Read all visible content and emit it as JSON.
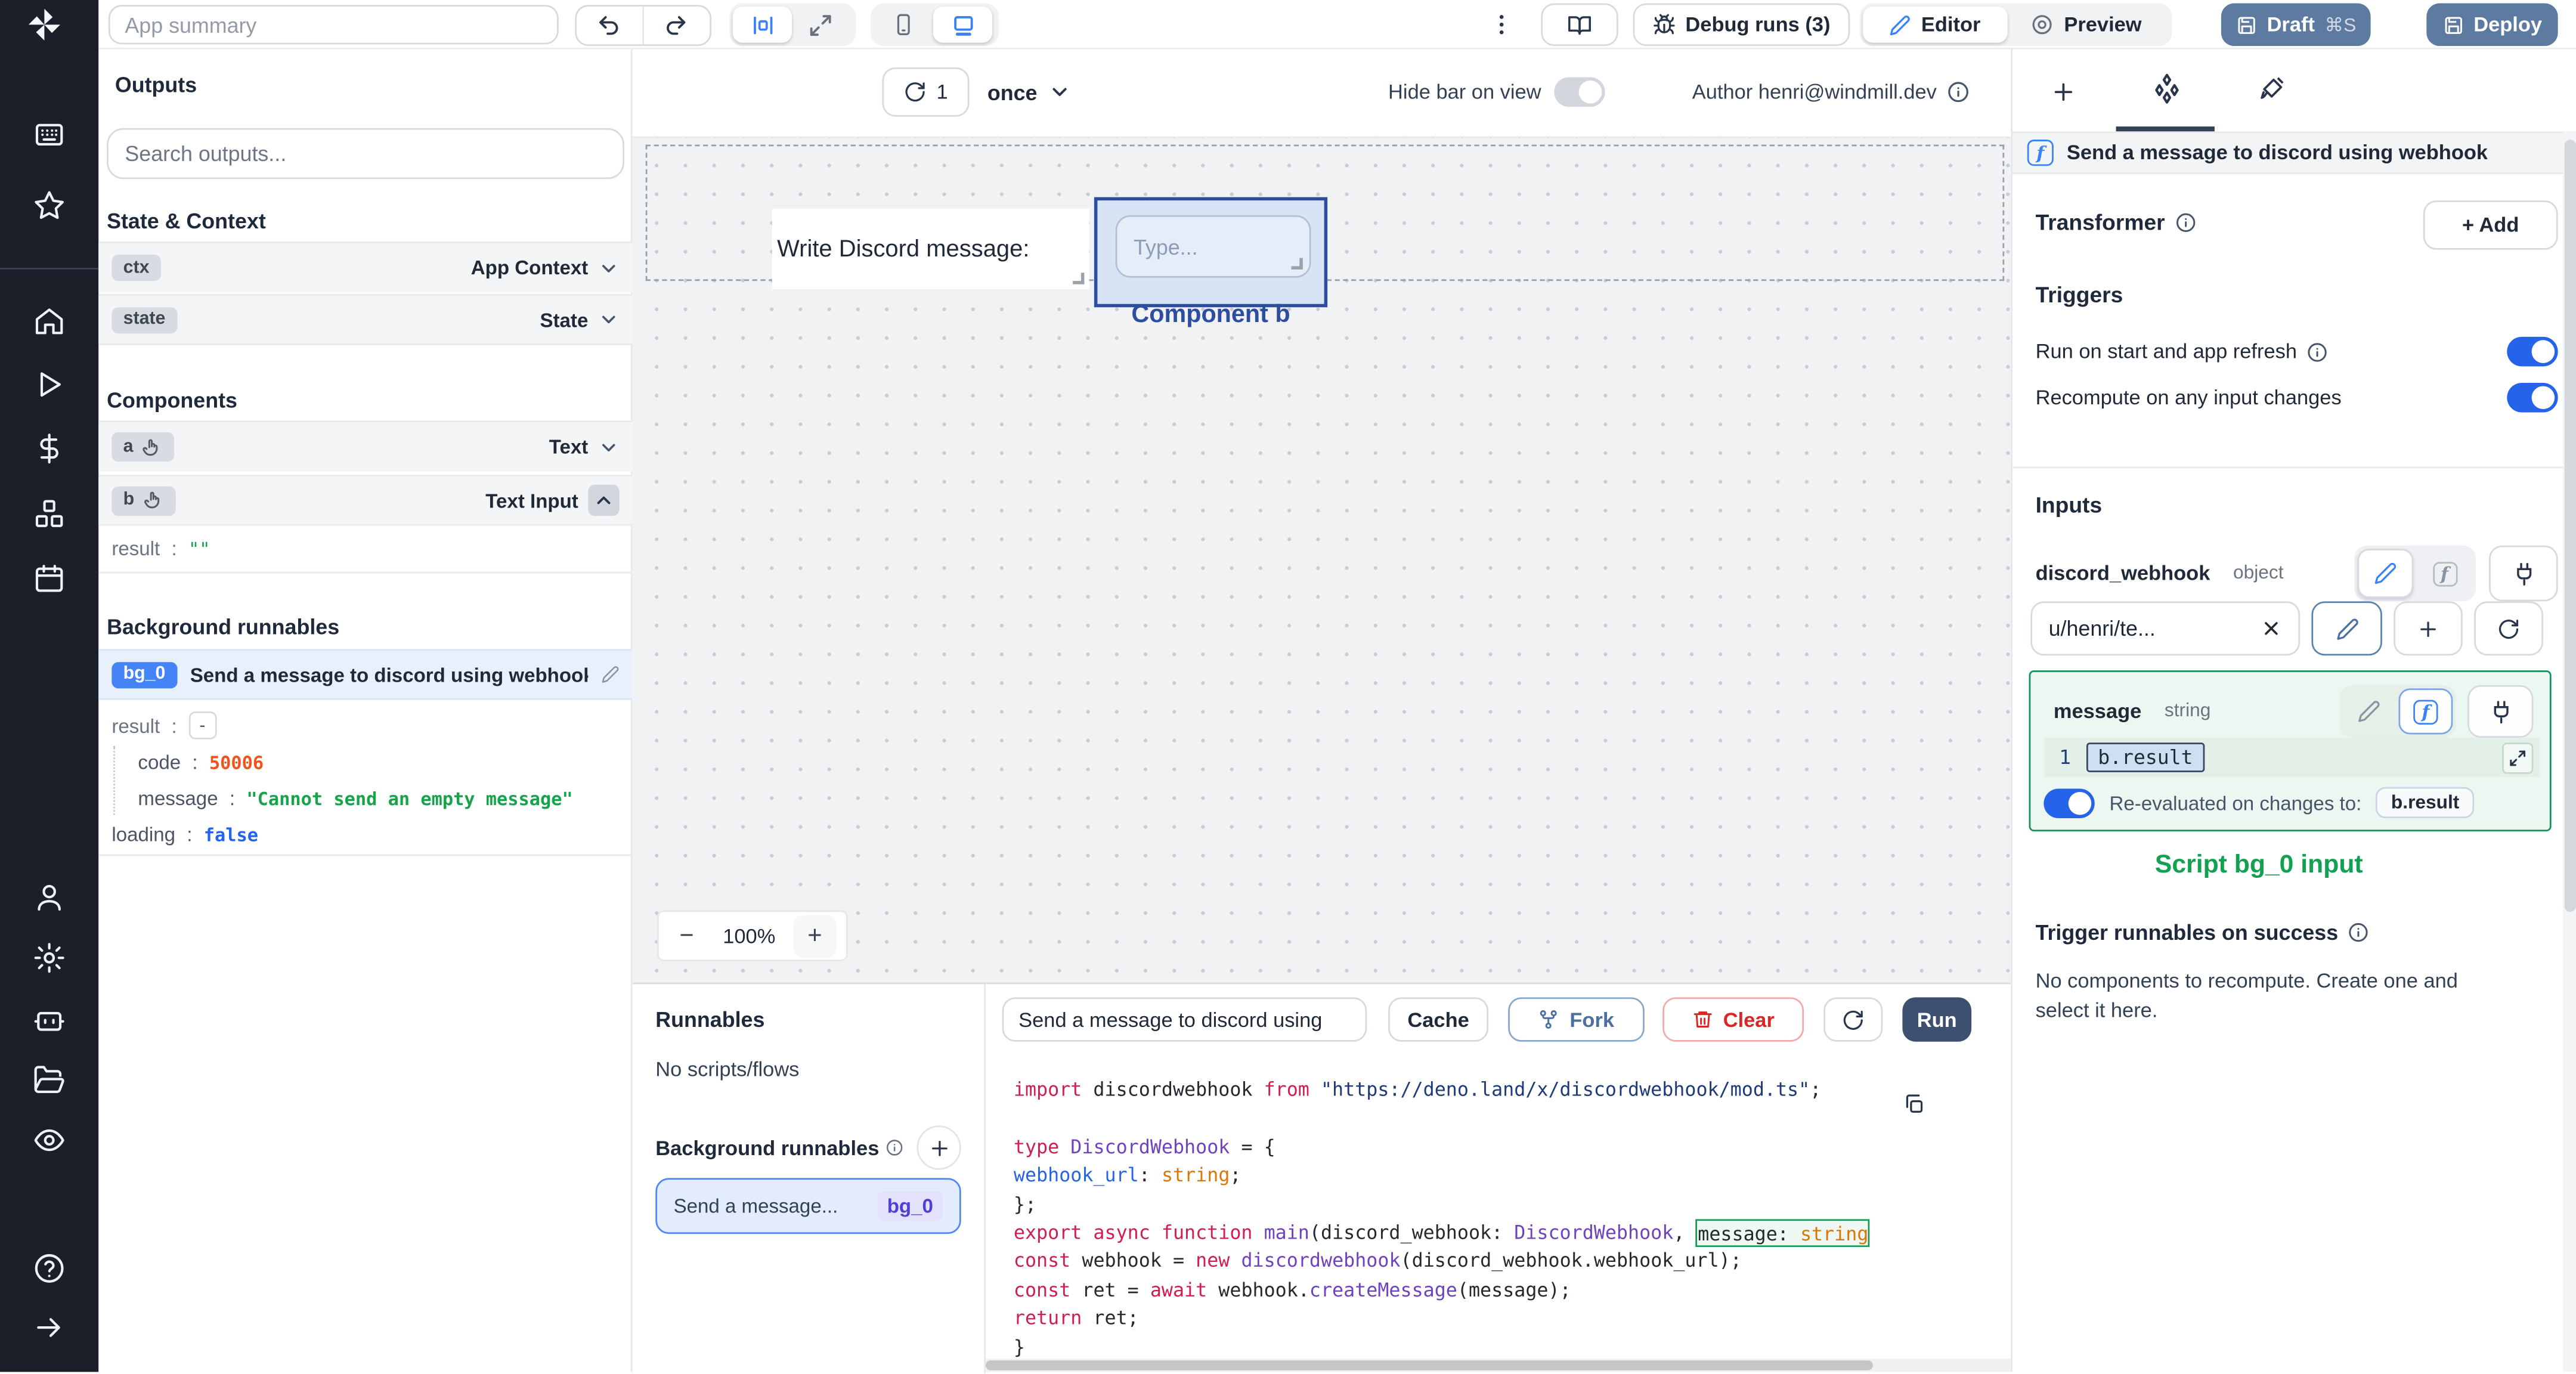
{
  "topbar": {
    "app_summary_placeholder": "App summary",
    "debug_runs_label": "Debug runs (3)",
    "editor_label": "Editor",
    "preview_label": "Preview",
    "draft_label": "Draft",
    "draft_shortcut": "⌘S",
    "deploy_label": "Deploy"
  },
  "canvas_toolbar": {
    "refresh_count": "1",
    "schedule_mode": "once",
    "hide_bar_label": "Hide bar on view",
    "author_label": "Author henri@windmill.dev"
  },
  "outputs_panel": {
    "title": "Outputs",
    "search_placeholder": "Search outputs...",
    "state_context_title": "State & Context",
    "ctx": {
      "key": "ctx",
      "type": "App Context"
    },
    "state": {
      "key": "state",
      "type": "State"
    },
    "components_title": "Components",
    "comp_a": {
      "key": "a",
      "type": "Text"
    },
    "comp_b": {
      "key": "b",
      "type": "Text Input",
      "result_key": "result",
      "result_value": "\"\""
    },
    "background_title": "Background runnables",
    "bg0": {
      "badge": "bg_0",
      "title": "Send a message to discord using webhook",
      "result_key": "result",
      "collapse": "-",
      "code_key": "code",
      "code_value": "50006",
      "message_key": "message",
      "message_value": "\"Cannot send an empty message\"",
      "loading_key": "loading",
      "loading_value": "false"
    }
  },
  "canvas": {
    "text_component": "Write Discord message:",
    "input_placeholder": "Type...",
    "selected_label": "Component b",
    "zoom_out": "−",
    "zoom_level": "100%",
    "zoom_in": "+"
  },
  "runnables_panel": {
    "title": "Runnables",
    "empty": "No scripts/flows",
    "background_title": "Background runnables",
    "card_title": "Send a message...",
    "card_badge": "bg_0"
  },
  "code_panel": {
    "name_value": "Send a message to discord using",
    "cache_label": "Cache",
    "fork_label": "Fork",
    "clear_label": "Clear",
    "run_label": "Run",
    "lines": [
      [
        {
          "c": "kw",
          "t": "import "
        },
        {
          "c": "pl",
          "t": "discordwebhook "
        },
        {
          "c": "kw",
          "t": "from "
        },
        {
          "c": "str",
          "t": "\"https://deno.land/x/discordwebhook/mod.ts\""
        },
        {
          "c": "pl",
          "t": ";"
        }
      ],
      [],
      [
        {
          "c": "kw",
          "t": "type "
        },
        {
          "c": "type",
          "t": "DiscordWebhook"
        },
        {
          "c": "pl",
          "t": " = {"
        }
      ],
      [
        {
          "c": "pl",
          "t": "  "
        },
        {
          "c": "prop",
          "t": "webhook_url"
        },
        {
          "c": "pl",
          "t": ": "
        },
        {
          "c": "btype",
          "t": "string"
        },
        {
          "c": "pl",
          "t": ";"
        }
      ],
      [
        {
          "c": "pl",
          "t": "};"
        }
      ],
      [
        {
          "c": "kw",
          "t": "export async function "
        },
        {
          "c": "fn",
          "t": "main"
        },
        {
          "c": "pl",
          "t": "(discord_webhook: "
        },
        {
          "c": "type",
          "t": "DiscordWebhook"
        },
        {
          "c": "pl",
          "t": ", "
        },
        {
          "c": "hl",
          "tokens": [
            {
              "c": "pl",
              "t": "message: "
            },
            {
              "c": "btype",
              "t": "string"
            }
          ]
        }
      ],
      [
        {
          "c": "pl",
          "t": "  "
        },
        {
          "c": "kw",
          "t": "const "
        },
        {
          "c": "pl",
          "t": "webhook = "
        },
        {
          "c": "kw",
          "t": "new "
        },
        {
          "c": "fn",
          "t": "discordwebhook"
        },
        {
          "c": "pl",
          "t": "(discord_webhook.webhook_url);"
        }
      ],
      [
        {
          "c": "pl",
          "t": "  "
        },
        {
          "c": "kw",
          "t": "const "
        },
        {
          "c": "pl",
          "t": "ret = "
        },
        {
          "c": "kw",
          "t": "await "
        },
        {
          "c": "pl",
          "t": "webhook."
        },
        {
          "c": "fn",
          "t": "createMessage"
        },
        {
          "c": "pl",
          "t": "(message);"
        }
      ],
      [
        {
          "c": "pl",
          "t": "  "
        },
        {
          "c": "kw",
          "t": "return "
        },
        {
          "c": "pl",
          "t": "ret;"
        }
      ],
      [
        {
          "c": "pl",
          "t": "}"
        }
      ]
    ]
  },
  "right_panel": {
    "header_title": "Send a message to discord using webhook",
    "transformer_title": "Transformer",
    "add_label": "+ Add",
    "triggers_title": "Triggers",
    "trigger_run_on_start": "Run on start and app refresh",
    "trigger_recompute": "Recompute on any input changes",
    "inputs_title": "Inputs",
    "input_webhook": {
      "name": "discord_webhook",
      "type": "object",
      "value": "u/henri/te..."
    },
    "input_message": {
      "name": "message",
      "type": "string",
      "line_number": "1",
      "expr": "b.result",
      "reeval_label": "Re-evaluated on changes to:",
      "reeval_target": "b.result"
    },
    "script_input_label": "Script bg_0 input",
    "on_success_title": "Trigger runnables on success",
    "on_success_text": "No components to recompute. Create one and select it here."
  },
  "colors": {
    "accent_blue": "#3b82f6",
    "selection_blue": "#2d4da0",
    "connect_green": "#11945a",
    "steel_button": "#5d7aa0",
    "run_button": "#3d5070"
  },
  "icons": [
    "windmill-logo",
    "undo",
    "redo",
    "align-center",
    "maximize",
    "phone",
    "monitor",
    "kebab-menu",
    "book",
    "bug",
    "pencil",
    "preview-circle",
    "save",
    "chevron-down",
    "chevron-up",
    "hand-pointer",
    "info-circle",
    "plus",
    "close-x",
    "refresh",
    "plug",
    "function-f",
    "git-fork",
    "trash",
    "copy-clipboard",
    "expand-diagonal"
  ]
}
